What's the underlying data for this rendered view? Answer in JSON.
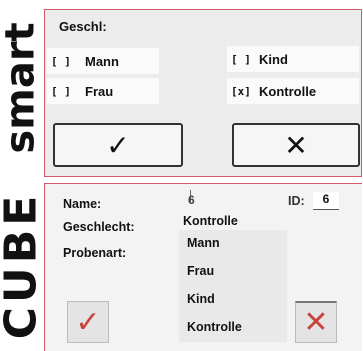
{
  "side_labels": {
    "top": "smart",
    "bottom": "CUBE"
  },
  "smart_panel": {
    "title": "Geschl:",
    "options": [
      {
        "box": "[ ]",
        "label": "Mann",
        "checked": false
      },
      {
        "box": "[ ]",
        "label": "Frau",
        "checked": false
      },
      {
        "box": "[ ]",
        "label": "Kind",
        "checked": false
      },
      {
        "box": "[x]",
        "label": "Kontrolle",
        "checked": true
      }
    ],
    "ok_button": {
      "glyph": "✓",
      "icon": "check-icon"
    },
    "cancel_button": {
      "glyph": "✕",
      "icon": "close-icon"
    }
  },
  "cube_panel": {
    "name_label": "Name:",
    "name_value": "6",
    "id_label": "ID:",
    "id_value": "6",
    "gender_label": "Geschlecht:",
    "sample_label": "Probenart:",
    "gender_selected": "Kontrolle",
    "gender_options": [
      "Mann",
      "Frau",
      "Kind",
      "Kontrolle"
    ],
    "ok_button": {
      "glyph": "✓",
      "icon": "check-icon",
      "color": "#c8453d"
    },
    "cancel_button": {
      "glyph": "✕",
      "icon": "close-icon",
      "color": "#c8453d"
    }
  },
  "colors": {
    "panel_border": "#d25a6a",
    "accent_red": "#c8453d"
  }
}
